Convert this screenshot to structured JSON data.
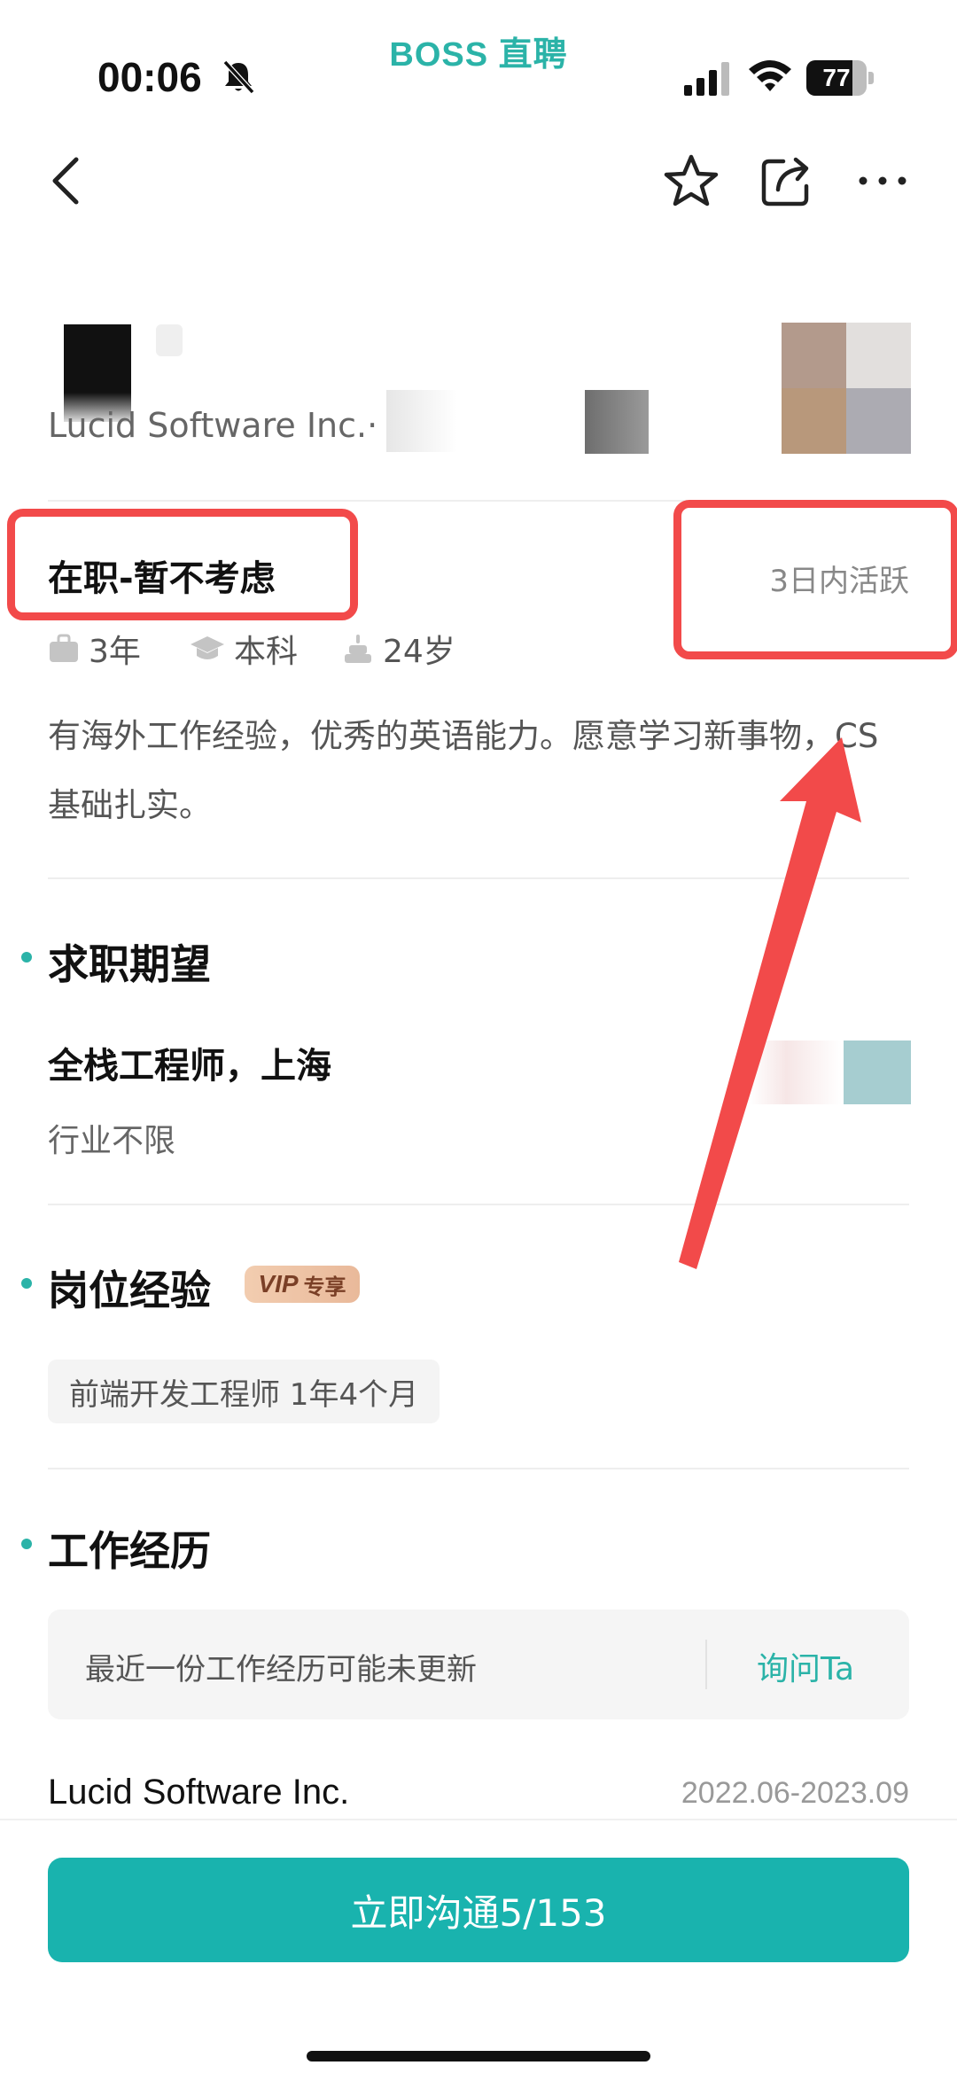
{
  "status_bar": {
    "app_watermark": "BOSS 直聘",
    "time": "00:06",
    "battery": "77",
    "battery_level": 0.77
  },
  "nav": {
    "back_icon": "chevron-left-icon",
    "favorite_icon": "star-icon",
    "share_icon": "share-icon",
    "more_icon": "more-icon"
  },
  "profile": {
    "company_line": "Lucid Software Inc.·"
  },
  "status": {
    "job_status": "在职-暂不考虑",
    "activity": "3日内活跃"
  },
  "meta": {
    "experience": "3年",
    "education": "本科",
    "age": "24岁"
  },
  "summary": "有海外工作经验，优秀的英语能力。愿意学习新事物，CS基础扎实。",
  "job_expectation": {
    "section_title": "求职期望",
    "position_city": "全栈工程师，上海",
    "industry": "行业不限"
  },
  "position_experience": {
    "section_title": "岗位经验",
    "vip_badge": "VIP",
    "vip_badge_suffix": "专享",
    "chip": "前端开发工程师 1年4个月"
  },
  "work_history": {
    "section_title": "工作经历",
    "notice": "最近一份工作经历可能未更新",
    "ask_link": "询问Ta",
    "company": "Lucid Software Inc.",
    "dates": "2022.06-2023.09"
  },
  "bottom": {
    "chat_button": "立即沟通5/153"
  },
  "colors": {
    "brand": "#19b3ae",
    "accent_teal": "#2bb3a8",
    "annotation_red": "#f24a4a"
  }
}
